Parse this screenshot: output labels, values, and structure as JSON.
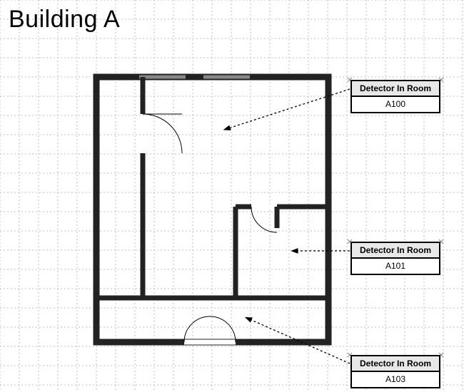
{
  "title": "Building A",
  "callouts": [
    {
      "label": "Detector In Room",
      "value": "A100"
    },
    {
      "label": "Detector In Room",
      "value": "A101"
    },
    {
      "label": "Detector In Room",
      "value": "A103"
    }
  ],
  "rooms": [
    "A100",
    "A101",
    "A103"
  ],
  "grid_spacing_px": 27
}
